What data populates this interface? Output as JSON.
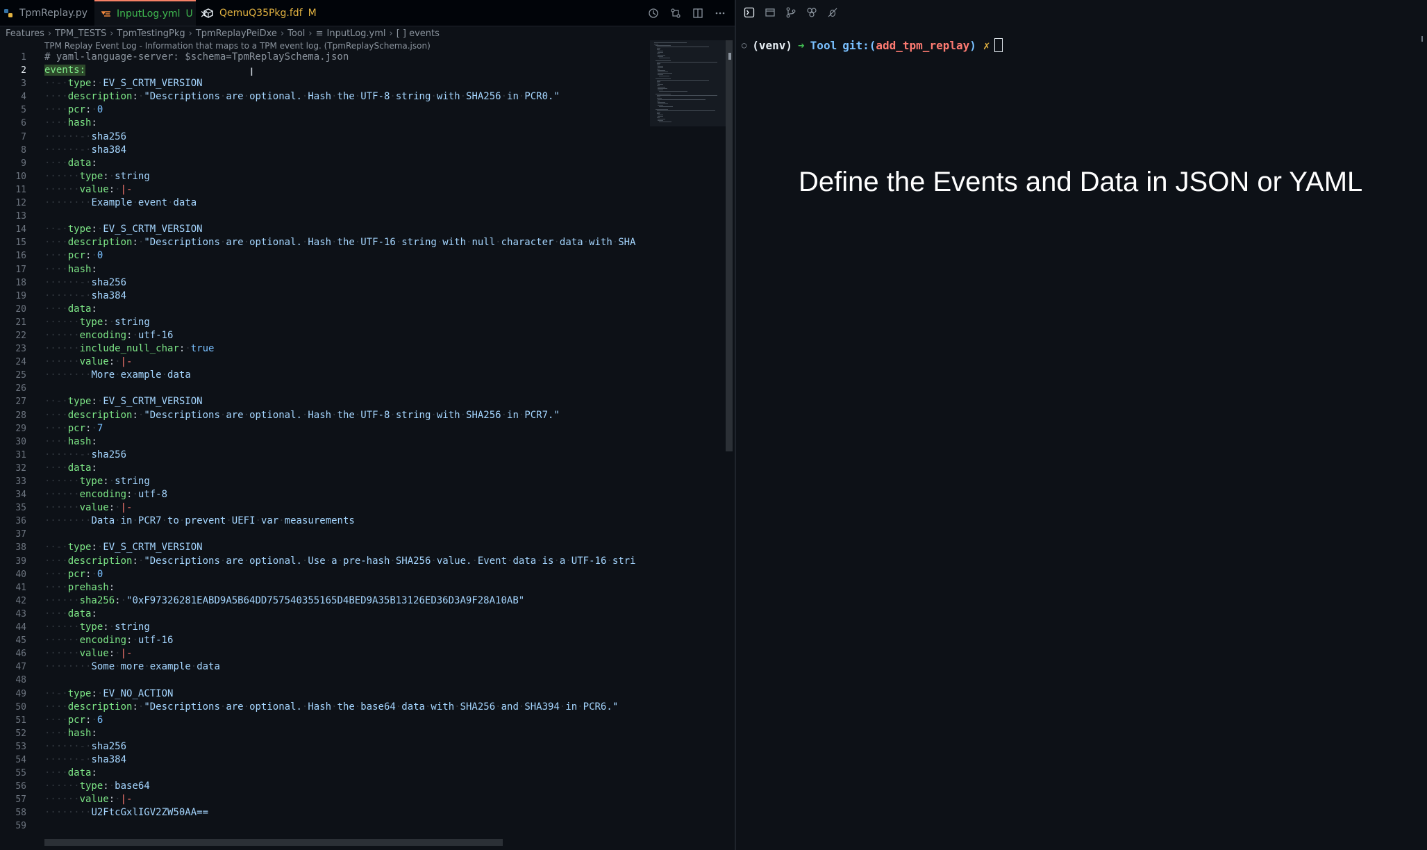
{
  "editor": {
    "tabs": [
      {
        "label": "TpmReplay.py",
        "modified": ""
      },
      {
        "label": "InputLog.yml",
        "modified": "U"
      },
      {
        "label": "QemuQ35Pkg.fdf",
        "modified": "M"
      }
    ],
    "close_glyph": "×",
    "breadcrumb": [
      "Features",
      "TPM_TESTS",
      "TpmTestingPkg",
      "TpmReplayPeiDxe",
      "Tool",
      "InputLog.yml",
      "[ ] events"
    ],
    "schema_hint": "TPM Replay Event Log - Information that maps to a TPM event log. (TpmReplaySchema.json)"
  },
  "terminal": {
    "venv": "(venv)",
    "arrow": "➜",
    "dir": "Tool",
    "git_label": "git:(",
    "branch": "add_tpm_replay",
    "git_close": ")",
    "dirty": "✗"
  },
  "caption": "Define the Events and Data in JSON or YAML",
  "colors": {
    "accent": "#f78166",
    "key": "#7ee787",
    "value": "#a5d6ff",
    "background": "#0d1117"
  }
}
